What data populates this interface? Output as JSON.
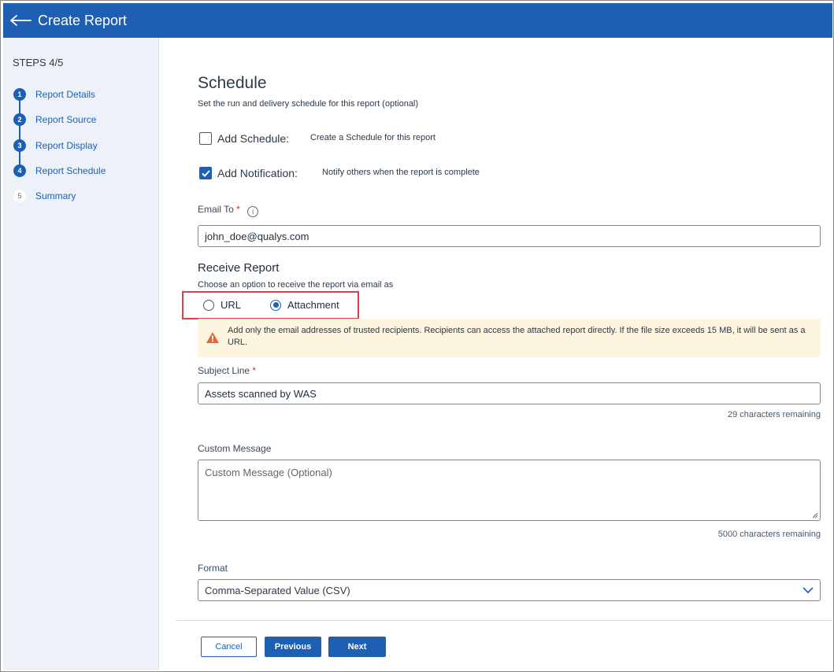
{
  "header": {
    "title": "Create Report",
    "back_icon": "arrow-left-icon"
  },
  "sidebar": {
    "steps_label": "STEPS 4/5",
    "steps": [
      {
        "num": "1",
        "label": "Report Details",
        "state": "complete"
      },
      {
        "num": "2",
        "label": "Report Source",
        "state": "complete"
      },
      {
        "num": "3",
        "label": "Report Display",
        "state": "complete"
      },
      {
        "num": "4",
        "label": "Report Schedule",
        "state": "current"
      },
      {
        "num": "5",
        "label": "Summary",
        "state": "pending"
      }
    ]
  },
  "main": {
    "title": "Schedule",
    "subtitle": "Set the run and delivery schedule for this report (optional)",
    "add_schedule": {
      "label": "Add Schedule:",
      "desc": "Create a Schedule for this report",
      "checked": false
    },
    "add_notification": {
      "label": "Add Notification:",
      "desc": "Notify others when the report is complete",
      "checked": true
    },
    "email_to": {
      "label": "Email To",
      "required_mark": "*",
      "info_icon": "i",
      "value": "john_doe@qualys.com"
    },
    "receive_report": {
      "title": "Receive Report",
      "subtitle": "Choose an option to receive the report via email as",
      "options": [
        "URL",
        "Attachment"
      ],
      "selected": "Attachment"
    },
    "warning": {
      "icon": "warning-triangle-icon",
      "text": "Add only the email addresses of trusted recipients. Recipients can access the attached report directly. If the file size exceeds 15 MB, it will be sent as a URL."
    },
    "subject_line": {
      "label": "Subject Line",
      "required_mark": "*",
      "value": "Assets scanned by WAS",
      "remaining": "29 characters remaining"
    },
    "custom_message": {
      "label": "Custom Message",
      "placeholder": "Custom Message (Optional)",
      "remaining": "5000 characters remaining"
    },
    "format": {
      "label": "Format",
      "value": "Comma-Separated Value (CSV)"
    }
  },
  "footer": {
    "cancel_label": "Cancel",
    "previous_label": "Previous",
    "next_label": "Next"
  },
  "colors": {
    "brand": "#1e5fb4",
    "warning_bg": "#fdf5dd",
    "warning_icon": "#e8623a",
    "highlight_border": "#d9404a",
    "required": "#d0312d"
  }
}
